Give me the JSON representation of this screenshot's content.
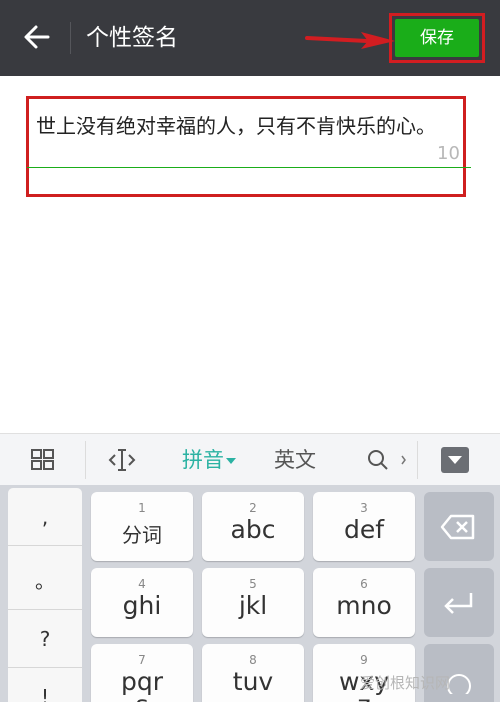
{
  "header": {
    "title": "个性签名",
    "save_label": "保存"
  },
  "editor": {
    "text": "世上没有绝对幸福的人，只有不肯快乐的心。",
    "remaining": "10"
  },
  "toolbar": {
    "pinyin": "拼音",
    "english": "英文"
  },
  "keyboard": {
    "punct": [
      ",",
      "。",
      "?",
      "!"
    ],
    "keys": [
      {
        "num": "1",
        "label": "分词"
      },
      {
        "num": "2",
        "label": "abc"
      },
      {
        "num": "3",
        "label": "def"
      },
      {
        "num": "4",
        "label": "ghi"
      },
      {
        "num": "5",
        "label": "jkl"
      },
      {
        "num": "6",
        "label": "mno"
      },
      {
        "num": "7",
        "label": "pqr"
      },
      {
        "num": "8",
        "label": "tuv"
      },
      {
        "num": "9",
        "label": "wxy"
      }
    ],
    "row3_second_line": [
      "s",
      "",
      "z"
    ]
  },
  "watermark": "爱创根知识网",
  "colors": {
    "header_bg": "#393a3f",
    "save_green": "#1aad19",
    "annotation_red": "#d21d21",
    "pinyin_accent": "#2bb2a3"
  }
}
